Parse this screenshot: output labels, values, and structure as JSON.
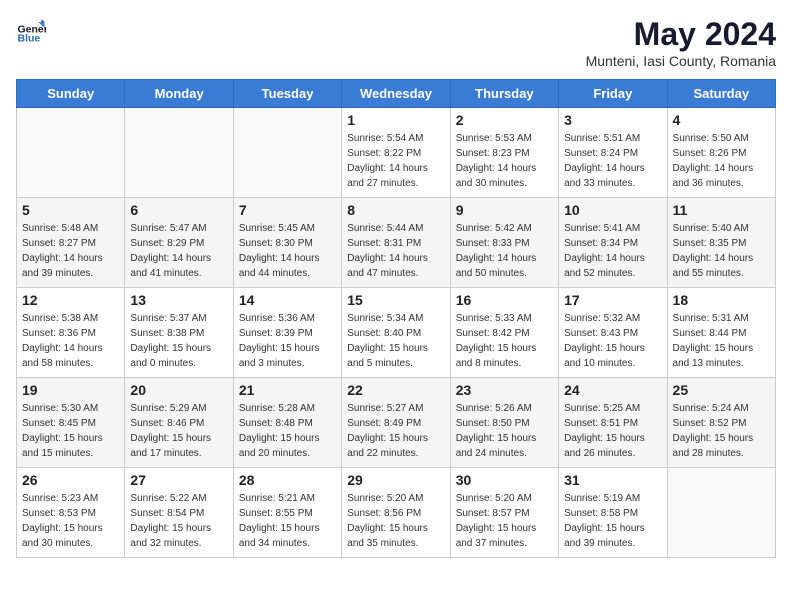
{
  "header": {
    "logo_general": "General",
    "logo_blue": "Blue",
    "month": "May 2024",
    "location": "Munteni, Iasi County, Romania"
  },
  "days_of_week": [
    "Sunday",
    "Monday",
    "Tuesday",
    "Wednesday",
    "Thursday",
    "Friday",
    "Saturday"
  ],
  "weeks": [
    [
      {
        "day": "",
        "info": ""
      },
      {
        "day": "",
        "info": ""
      },
      {
        "day": "",
        "info": ""
      },
      {
        "day": "1",
        "info": "Sunrise: 5:54 AM\nSunset: 8:22 PM\nDaylight: 14 hours\nand 27 minutes."
      },
      {
        "day": "2",
        "info": "Sunrise: 5:53 AM\nSunset: 8:23 PM\nDaylight: 14 hours\nand 30 minutes."
      },
      {
        "day": "3",
        "info": "Sunrise: 5:51 AM\nSunset: 8:24 PM\nDaylight: 14 hours\nand 33 minutes."
      },
      {
        "day": "4",
        "info": "Sunrise: 5:50 AM\nSunset: 8:26 PM\nDaylight: 14 hours\nand 36 minutes."
      }
    ],
    [
      {
        "day": "5",
        "info": "Sunrise: 5:48 AM\nSunset: 8:27 PM\nDaylight: 14 hours\nand 39 minutes."
      },
      {
        "day": "6",
        "info": "Sunrise: 5:47 AM\nSunset: 8:29 PM\nDaylight: 14 hours\nand 41 minutes."
      },
      {
        "day": "7",
        "info": "Sunrise: 5:45 AM\nSunset: 8:30 PM\nDaylight: 14 hours\nand 44 minutes."
      },
      {
        "day": "8",
        "info": "Sunrise: 5:44 AM\nSunset: 8:31 PM\nDaylight: 14 hours\nand 47 minutes."
      },
      {
        "day": "9",
        "info": "Sunrise: 5:42 AM\nSunset: 8:33 PM\nDaylight: 14 hours\nand 50 minutes."
      },
      {
        "day": "10",
        "info": "Sunrise: 5:41 AM\nSunset: 8:34 PM\nDaylight: 14 hours\nand 52 minutes."
      },
      {
        "day": "11",
        "info": "Sunrise: 5:40 AM\nSunset: 8:35 PM\nDaylight: 14 hours\nand 55 minutes."
      }
    ],
    [
      {
        "day": "12",
        "info": "Sunrise: 5:38 AM\nSunset: 8:36 PM\nDaylight: 14 hours\nand 58 minutes."
      },
      {
        "day": "13",
        "info": "Sunrise: 5:37 AM\nSunset: 8:38 PM\nDaylight: 15 hours\nand 0 minutes."
      },
      {
        "day": "14",
        "info": "Sunrise: 5:36 AM\nSunset: 8:39 PM\nDaylight: 15 hours\nand 3 minutes."
      },
      {
        "day": "15",
        "info": "Sunrise: 5:34 AM\nSunset: 8:40 PM\nDaylight: 15 hours\nand 5 minutes."
      },
      {
        "day": "16",
        "info": "Sunrise: 5:33 AM\nSunset: 8:42 PM\nDaylight: 15 hours\nand 8 minutes."
      },
      {
        "day": "17",
        "info": "Sunrise: 5:32 AM\nSunset: 8:43 PM\nDaylight: 15 hours\nand 10 minutes."
      },
      {
        "day": "18",
        "info": "Sunrise: 5:31 AM\nSunset: 8:44 PM\nDaylight: 15 hours\nand 13 minutes."
      }
    ],
    [
      {
        "day": "19",
        "info": "Sunrise: 5:30 AM\nSunset: 8:45 PM\nDaylight: 15 hours\nand 15 minutes."
      },
      {
        "day": "20",
        "info": "Sunrise: 5:29 AM\nSunset: 8:46 PM\nDaylight: 15 hours\nand 17 minutes."
      },
      {
        "day": "21",
        "info": "Sunrise: 5:28 AM\nSunset: 8:48 PM\nDaylight: 15 hours\nand 20 minutes."
      },
      {
        "day": "22",
        "info": "Sunrise: 5:27 AM\nSunset: 8:49 PM\nDaylight: 15 hours\nand 22 minutes."
      },
      {
        "day": "23",
        "info": "Sunrise: 5:26 AM\nSunset: 8:50 PM\nDaylight: 15 hours\nand 24 minutes."
      },
      {
        "day": "24",
        "info": "Sunrise: 5:25 AM\nSunset: 8:51 PM\nDaylight: 15 hours\nand 26 minutes."
      },
      {
        "day": "25",
        "info": "Sunrise: 5:24 AM\nSunset: 8:52 PM\nDaylight: 15 hours\nand 28 minutes."
      }
    ],
    [
      {
        "day": "26",
        "info": "Sunrise: 5:23 AM\nSunset: 8:53 PM\nDaylight: 15 hours\nand 30 minutes."
      },
      {
        "day": "27",
        "info": "Sunrise: 5:22 AM\nSunset: 8:54 PM\nDaylight: 15 hours\nand 32 minutes."
      },
      {
        "day": "28",
        "info": "Sunrise: 5:21 AM\nSunset: 8:55 PM\nDaylight: 15 hours\nand 34 minutes."
      },
      {
        "day": "29",
        "info": "Sunrise: 5:20 AM\nSunset: 8:56 PM\nDaylight: 15 hours\nand 35 minutes."
      },
      {
        "day": "30",
        "info": "Sunrise: 5:20 AM\nSunset: 8:57 PM\nDaylight: 15 hours\nand 37 minutes."
      },
      {
        "day": "31",
        "info": "Sunrise: 5:19 AM\nSunset: 8:58 PM\nDaylight: 15 hours\nand 39 minutes."
      },
      {
        "day": "",
        "info": ""
      }
    ]
  ]
}
